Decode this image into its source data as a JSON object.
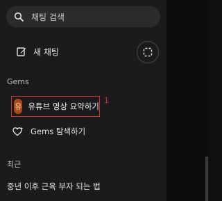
{
  "search": {
    "placeholder": "채팅 검색",
    "icon": "search-icon"
  },
  "new_chat": {
    "label": "새 채팅",
    "icon": "edit-icon"
  },
  "grid_button": {
    "icon": "dashed-square-icon"
  },
  "gems": {
    "section_title": "Gems",
    "items": [
      {
        "avatar_text": "유",
        "label": "유튜브 영상 요약하기"
      }
    ],
    "marker": "1",
    "explore": {
      "label": "Gems 탐색하기",
      "icon": "heart-sparkle-icon"
    }
  },
  "recent": {
    "section_title": "최근",
    "items": [
      {
        "label": "중년 이후 근육 부자 되는 법"
      }
    ]
  },
  "colors": {
    "sidebar_bg": "#1b1b1d",
    "highlight_border": "#d0312d",
    "avatar_bg": "#a54a1b"
  }
}
